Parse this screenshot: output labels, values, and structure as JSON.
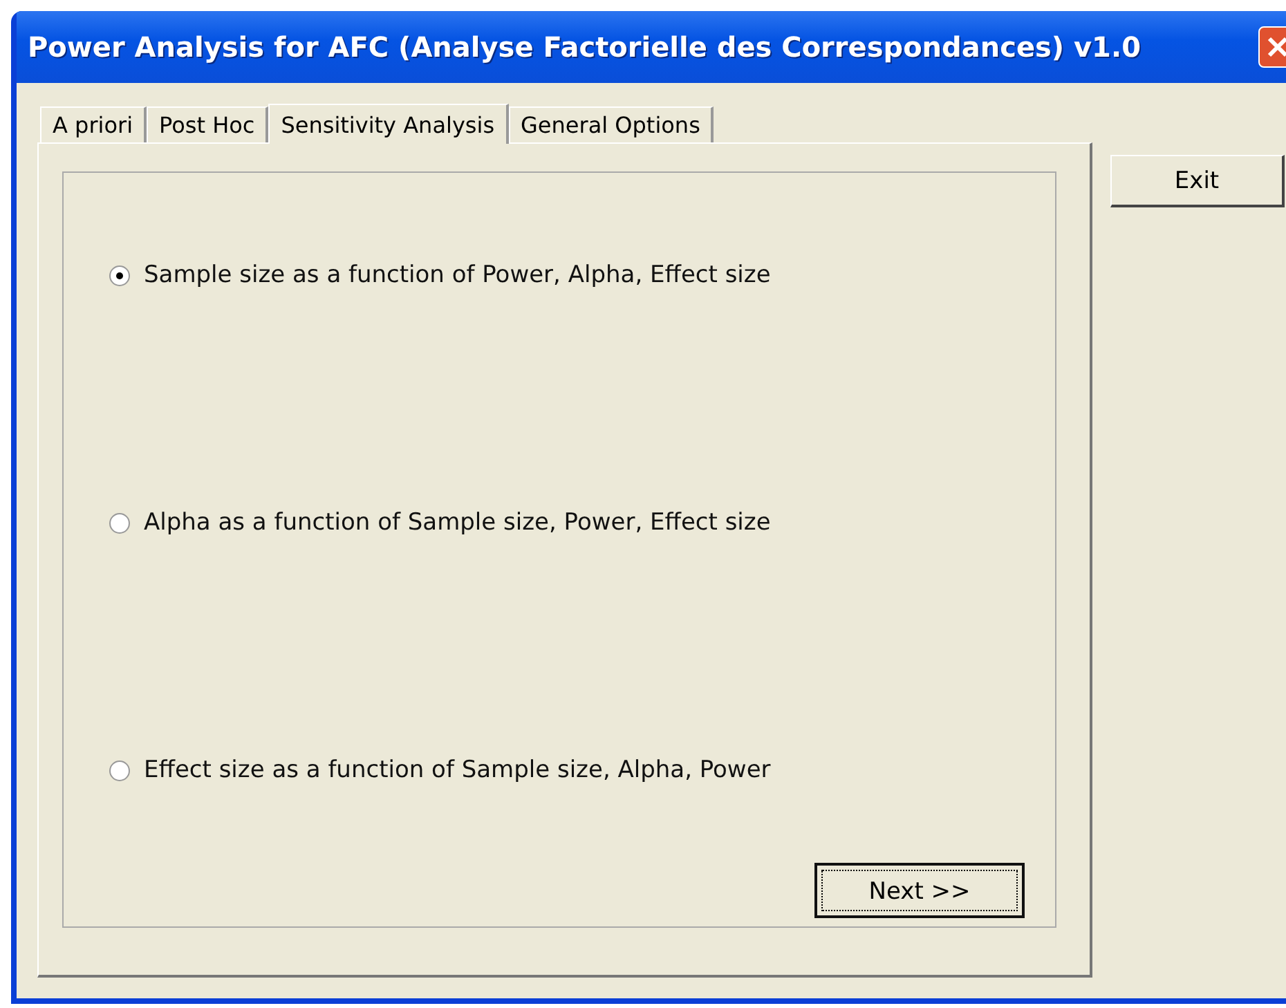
{
  "window": {
    "title": "Power Analysis for AFC (Analyse Factorielle des Correspondances) v1.0"
  },
  "tabs": [
    {
      "label": "A priori",
      "selected": false
    },
    {
      "label": "Post Hoc",
      "selected": false
    },
    {
      "label": "Sensitivity Analysis",
      "selected": true
    },
    {
      "label": "General Options",
      "selected": false
    }
  ],
  "options": [
    {
      "label": "Sample size as a function of Power, Alpha, Effect size",
      "selected": true
    },
    {
      "label": "Alpha as a function of Sample size, Power, Effect size",
      "selected": false
    },
    {
      "label": "Effect size as a function of Sample size, Alpha, Power",
      "selected": false
    }
  ],
  "next_button": "Next >>",
  "exit_button": "Exit"
}
